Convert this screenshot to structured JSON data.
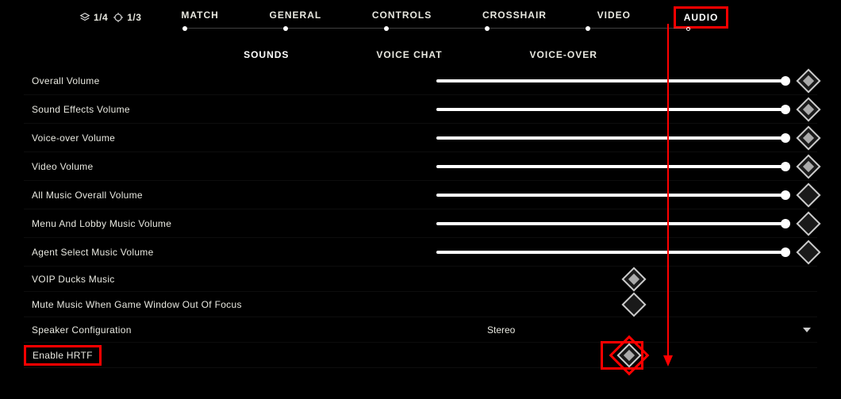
{
  "indicators": {
    "left": "1/4",
    "right": "1/3"
  },
  "nav": {
    "tabs": [
      {
        "label": "MATCH"
      },
      {
        "label": "GENERAL"
      },
      {
        "label": "CONTROLS"
      },
      {
        "label": "CROSSHAIR"
      },
      {
        "label": "VIDEO"
      },
      {
        "label": "AUDIO",
        "active": true
      }
    ]
  },
  "subnav": {
    "tabs": [
      {
        "label": "SOUNDS",
        "active": true
      },
      {
        "label": "VOICE CHAT"
      },
      {
        "label": "VOICE-OVER"
      }
    ]
  },
  "settings": [
    {
      "label": "Overall Volume",
      "type": "slider",
      "value": 100,
      "reset_filled": true
    },
    {
      "label": "Sound Effects Volume",
      "type": "slider",
      "value": 100,
      "reset_filled": true
    },
    {
      "label": "Voice-over Volume",
      "type": "slider",
      "value": 100,
      "reset_filled": true
    },
    {
      "label": "Video Volume",
      "type": "slider",
      "value": 100,
      "reset_filled": true
    },
    {
      "label": "All Music Overall Volume",
      "type": "slider",
      "value": 100,
      "reset_filled": false
    },
    {
      "label": "Menu And Lobby Music Volume",
      "type": "slider",
      "value": 100,
      "reset_filled": false
    },
    {
      "label": "Agent Select Music Volume",
      "type": "slider",
      "value": 100,
      "reset_filled": false
    },
    {
      "label": "VOIP Ducks Music",
      "type": "toggle",
      "state": "on"
    },
    {
      "label": "Mute Music When Game Window Out Of Focus",
      "type": "toggle",
      "state": "off"
    },
    {
      "label": "Speaker Configuration",
      "type": "select",
      "value": "Stereo"
    },
    {
      "label": "Enable HRTF",
      "type": "toggle",
      "state": "on",
      "highlight": true
    }
  ],
  "annotation": {
    "highlight_tab": "AUDIO",
    "highlight_setting": "Enable HRTF",
    "color": "#ff0000"
  }
}
